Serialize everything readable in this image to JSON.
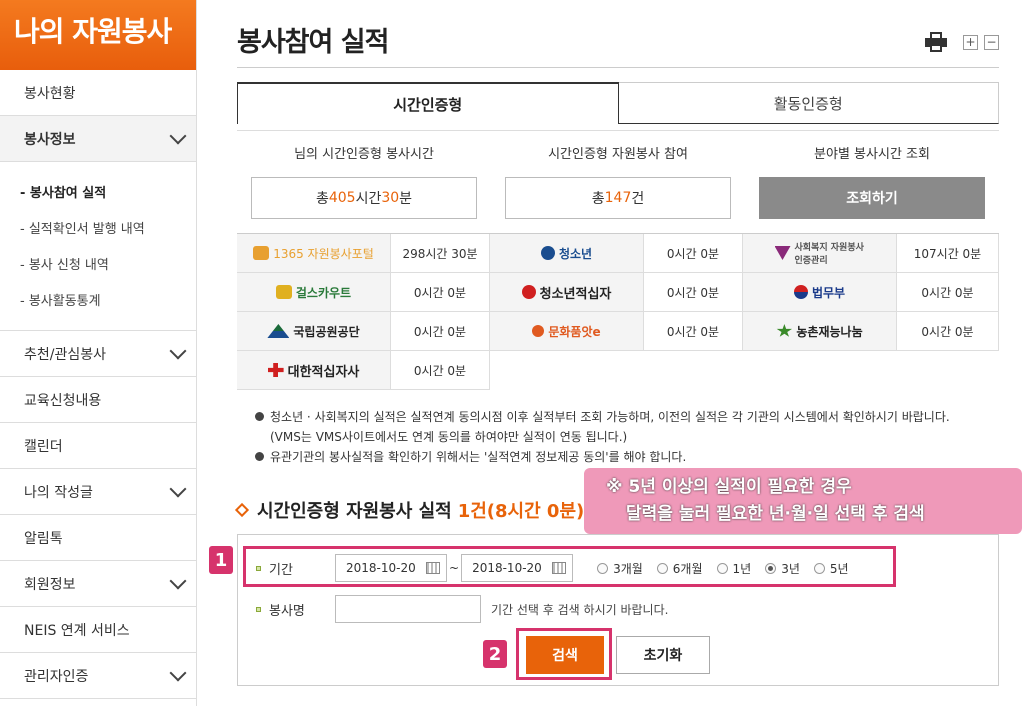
{
  "sidebar": {
    "title": "나의 자원봉사",
    "items": [
      {
        "label": "봉사현황",
        "has_chevron": false
      },
      {
        "label": "봉사정보",
        "has_chevron": true
      }
    ],
    "sub_items": [
      "- 봉사참여 실적",
      "- 실적확인서 발행 내역",
      "- 봉사 신청 내역",
      "- 봉사활동통계"
    ],
    "items_after": [
      {
        "label": "추천/관심봉사",
        "has_chevron": true
      },
      {
        "label": "교육신청내용",
        "has_chevron": false
      },
      {
        "label": "캘린더",
        "has_chevron": false
      },
      {
        "label": "나의 작성글",
        "has_chevron": true
      },
      {
        "label": "알림톡",
        "has_chevron": false
      },
      {
        "label": "회원정보",
        "has_chevron": true
      },
      {
        "label": "NEIS 연계 서비스",
        "has_chevron": false
      },
      {
        "label": "관리자인증",
        "has_chevron": true
      }
    ]
  },
  "page": {
    "title": "봉사참여 실적",
    "zoom_in": "+",
    "zoom_out": "−"
  },
  "tabs": [
    {
      "label": "시간인증형",
      "active": true
    },
    {
      "label": "활동인증형",
      "active": false
    }
  ],
  "summary": {
    "hours_label": "님의 시간인증형 봉사시간",
    "hours_prefix": "총 ",
    "hours_value": "405",
    "hours_unit": "시간 ",
    "minutes_value": "30",
    "minutes_unit": "분",
    "count_label": "시간인증형 자원봉사 참여",
    "count_prefix": "총 ",
    "count_value": "147",
    "count_unit": "건",
    "field_label": "분야별 봉사시간 조회",
    "field_button": "조회하기"
  },
  "orgs": [
    {
      "name": "1365 자원봉사포털",
      "value": "298시간 30분",
      "color": "#e8a030"
    },
    {
      "name": "청소년",
      "value": "0시간 0분",
      "color": "#1a4d8f"
    },
    {
      "name": "사회복지 자원봉사인증관리",
      "value": "107시간 0분",
      "color": "#8a2a7a"
    },
    {
      "name": "걸스카우트",
      "value": "0시간 0분",
      "color": "#2a7a3a"
    },
    {
      "name": "청소년적십자",
      "value": "0시간 0분",
      "color": "#d02020"
    },
    {
      "name": "법무부",
      "value": "0시간 0분",
      "color": "#1a3a8a"
    },
    {
      "name": "국립공원공단",
      "value": "0시간 0분",
      "color": "#1a6a3a"
    },
    {
      "name": "문화품앗e",
      "value": "0시간 0분",
      "color": "#e05a20"
    },
    {
      "name": "농촌재능나눔",
      "value": "0시간 0분",
      "color": "#3a8a2a"
    },
    {
      "name": "대한적십자사",
      "value": "0시간 0분",
      "color": "#d02020"
    }
  ],
  "notes": [
    {
      "line1": "청소년 · 사회복지의 실적은 실적연계 동의시점 이후 실적부터 조회 가능하며, 이전의 실적은 각 기관의 시스템에서 확인하시기 바랍니다.",
      "line2": "(VMS는 VMS사이트에서도 연계 동의를 하여야만 실적이 연동 됩니다.)"
    },
    {
      "line1": "유관기관의 봉사실적을 확인하기 위해서는 '실적연계 정보제공 동의'를 해야 합니다.",
      "line2": ""
    }
  ],
  "section": {
    "title": "시간인증형 자원봉사 실적",
    "count": "1건(8시간 0분)"
  },
  "callout": {
    "line1": "※ 5년 이상의 실적이 필요한 경우",
    "line2": "달력을 눌러 필요한 년·월·일 선택 후 검색"
  },
  "search": {
    "period_label": "기간",
    "start_date": "2018-10-20",
    "end_date": "2018-10-20",
    "tilde": "~",
    "periods": [
      {
        "label": "3개월",
        "selected": false
      },
      {
        "label": "6개월",
        "selected": false
      },
      {
        "label": "1년",
        "selected": false
      },
      {
        "label": "3년",
        "selected": true
      },
      {
        "label": "5년",
        "selected": false
      }
    ],
    "name_label": "봉사명",
    "name_value": "",
    "hint": "기간 선택 후 검색 하시기 바랍니다.",
    "search_button": "검색",
    "reset_button": "초기화"
  },
  "annotations": {
    "badge1": "1",
    "badge2": "2",
    "color": "#d6336c"
  }
}
